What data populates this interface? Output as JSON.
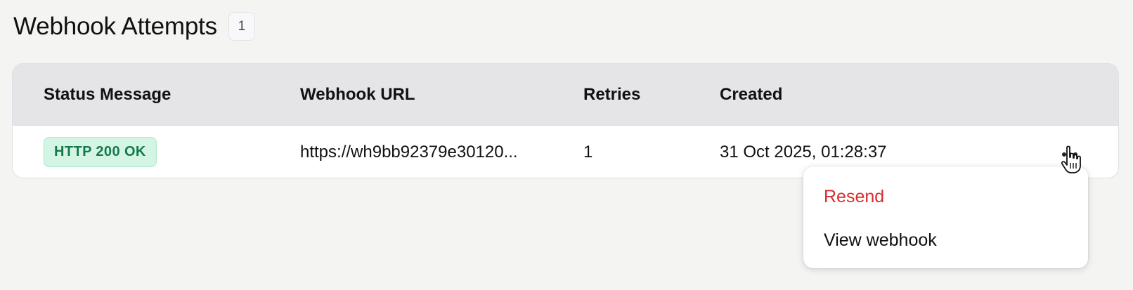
{
  "header": {
    "title": "Webhook Attempts",
    "count": "1"
  },
  "table": {
    "columns": [
      "Status Message",
      "Webhook URL",
      "Retries",
      "Created"
    ],
    "rows": [
      {
        "status": "HTTP 200 OK",
        "url": "https://wh9bb92379e30120...",
        "retries": "1",
        "created": "31 Oct 2025, 01:28:37"
      }
    ]
  },
  "row_menu": {
    "icon": "ellipsis-icon",
    "items": [
      {
        "label": "Resend",
        "tone": "danger"
      },
      {
        "label": "View webhook",
        "tone": "default"
      }
    ]
  },
  "colors": {
    "status_ok_bg": "#d4f5e4",
    "status_ok_text": "#157a4a",
    "danger": "#d92c2c"
  }
}
